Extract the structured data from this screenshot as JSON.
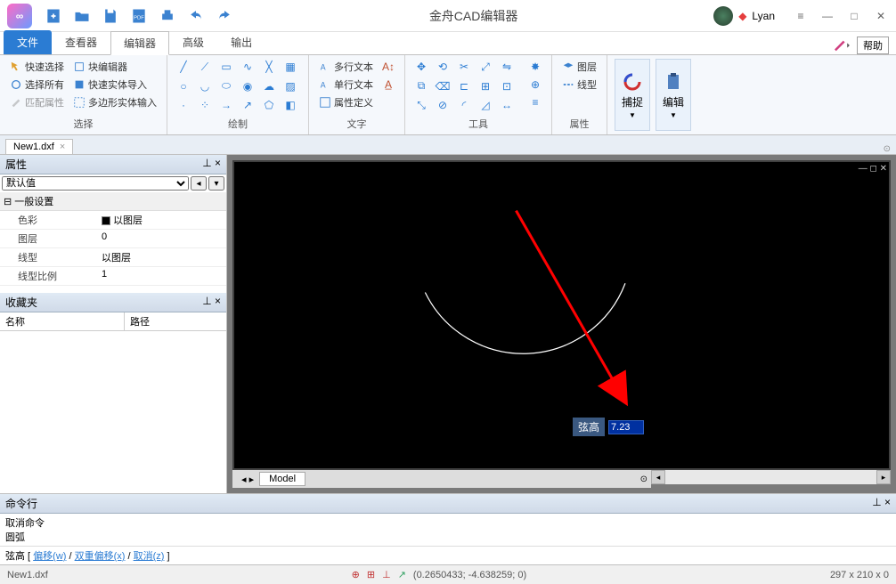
{
  "app": {
    "title": "金舟CAD编辑器",
    "user": "Lyan"
  },
  "ribbon": {
    "tabs": {
      "file": "文件",
      "viewer": "查看器",
      "editor": "编辑器",
      "advanced": "高级",
      "output": "输出"
    },
    "help": "帮助"
  },
  "groups": {
    "select": {
      "label": "选择",
      "items": {
        "quick_select": "快速选择",
        "select_all": "选择所有",
        "match_attr": "匹配属性",
        "block_editor": "块编辑器",
        "quick_entity_import": "快速实体导入",
        "polygon_entity_input": "多边形实体输入"
      }
    },
    "draw": {
      "label": "绘制"
    },
    "text": {
      "label": "文字",
      "items": {
        "multi_text": "多行文本",
        "single_text": "单行文本",
        "attr_def": "属性定义"
      }
    },
    "tools": {
      "label": "工具"
    },
    "props": {
      "label": "属性",
      "items": {
        "layer": "图层",
        "linetype": "线型"
      }
    },
    "capture": "捕捉",
    "edit": "编辑"
  },
  "doc": {
    "current": "New1.dxf"
  },
  "panels": {
    "properties": {
      "title": "属性",
      "dropdown": "默认值",
      "section": "一般设置",
      "rows": {
        "color": {
          "key": "色彩",
          "val": "以图层"
        },
        "layer": {
          "key": "图层",
          "val": "0"
        },
        "linetype": {
          "key": "线型",
          "val": "以图层"
        },
        "ltscale": {
          "key": "线型比例",
          "val": "1"
        }
      }
    },
    "favorites": {
      "title": "收藏夹",
      "col_name": "名称",
      "col_path": "路径"
    },
    "command": {
      "title": "命令行",
      "log": [
        "取消命令",
        "圆弧"
      ],
      "prompt_base": "弦高",
      "options": {
        "offset": "偏移(w)",
        "double_offset": "双重偏移(x)",
        "cancel": "取消(z)"
      }
    }
  },
  "canvas": {
    "input_label": "弦高",
    "input_value": "7.23",
    "model_tab": "Model"
  },
  "status": {
    "file": "New1.dxf",
    "coords": "(0.2650433; -4.638259; 0)",
    "dims": "297 x 210 x 0"
  }
}
